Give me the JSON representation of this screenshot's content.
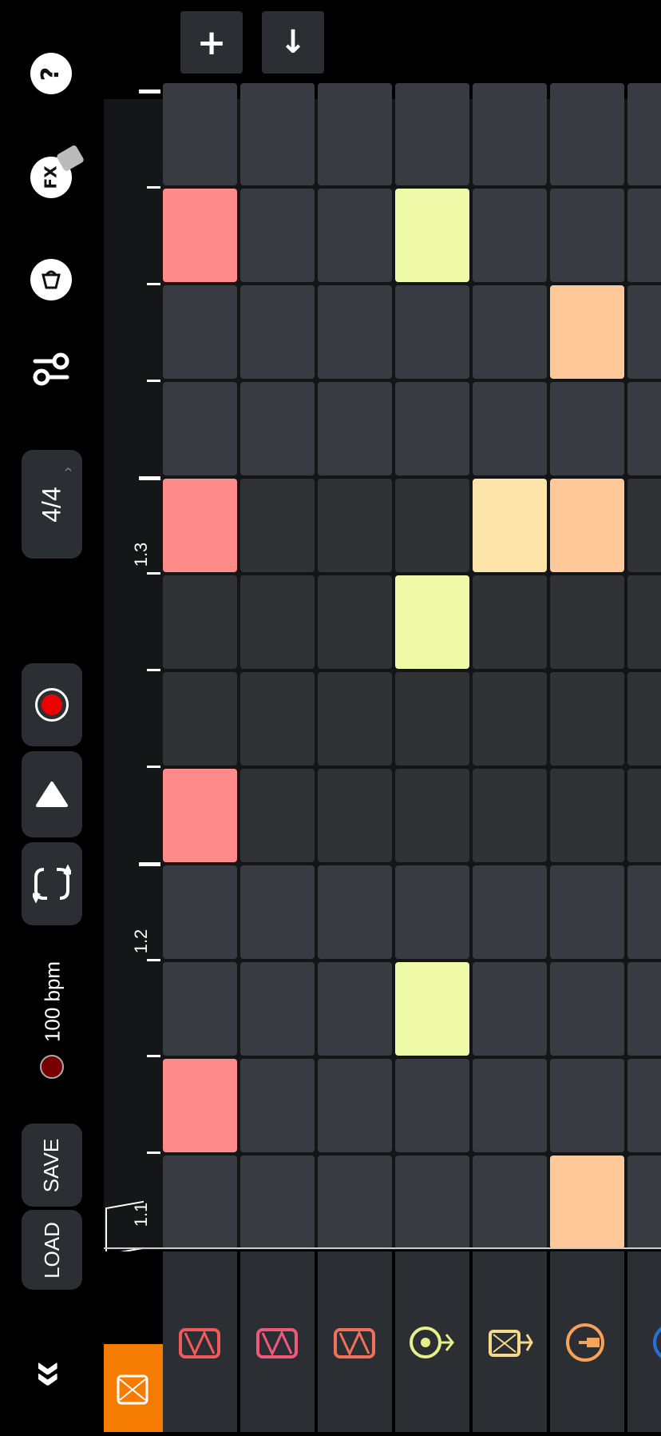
{
  "toolbar": {
    "add_label": "+",
    "down_label": "↓",
    "help_label": "?",
    "fx_label": "FX",
    "time_signature": "4/4",
    "tempo": "100 bpm",
    "save_label": "SAVE",
    "load_label": "LOAD",
    "collapse_label": "»"
  },
  "ruler": {
    "labels": [
      "1.1",
      "1.2",
      "1.3"
    ]
  },
  "instruments": [
    {
      "name": "drum-kit-tab",
      "color": "#f57c00"
    },
    {
      "name": "snare-drum-1",
      "color": "#f05a5a"
    },
    {
      "name": "snare-drum-2",
      "color": "#f05a7a"
    },
    {
      "name": "snare-drum-3",
      "color": "#f0705a"
    },
    {
      "name": "hi-hat",
      "color": "#e6f08a"
    },
    {
      "name": "cymbal-drum",
      "color": "#f7d98a"
    },
    {
      "name": "tom",
      "color": "#f5a25a"
    },
    {
      "name": "extra",
      "color": "#2a6fd6"
    }
  ],
  "colors": {
    "cell_empty": "#383b41",
    "cell_empty_alt": "#303236",
    "track1": "#ff8a8a",
    "track4": "#eefaa8",
    "track5": "#fde4a8",
    "track6": "#fec898"
  },
  "active_steps": [
    {
      "track": 0,
      "step": 1
    },
    {
      "track": 0,
      "step": 4
    },
    {
      "track": 0,
      "step": 7
    },
    {
      "track": 0,
      "step": 10
    },
    {
      "track": 3,
      "step": 2
    },
    {
      "track": 3,
      "step": 6
    },
    {
      "track": 3,
      "step": 10
    },
    {
      "track": 4,
      "step": 7
    },
    {
      "track": 5,
      "step": 0
    },
    {
      "track": 5,
      "step": 7
    },
    {
      "track": 5,
      "step": 9
    }
  ]
}
